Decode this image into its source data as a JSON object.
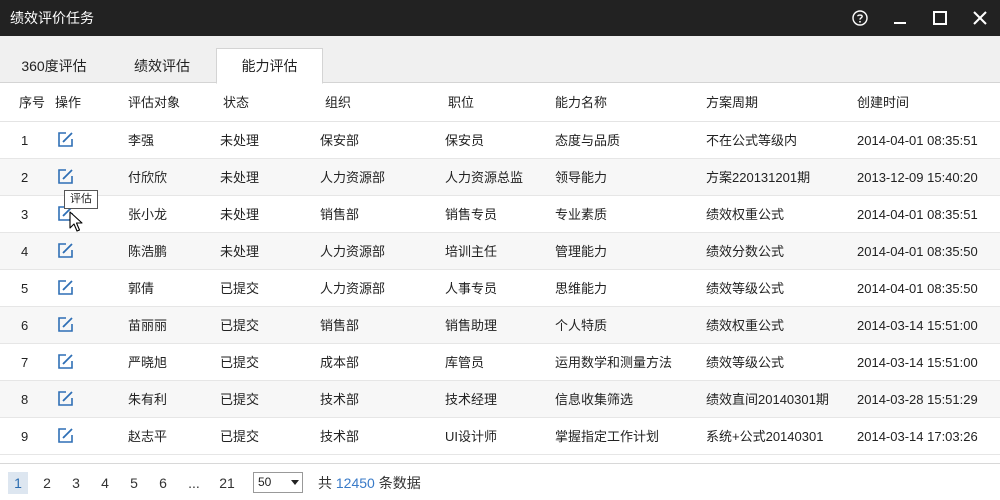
{
  "window": {
    "title": "绩效评价任务",
    "help_icon": "help-circle-icon",
    "minimize_icon": "minimize-icon",
    "maximize_icon": "maximize-icon",
    "close_icon": "close-icon"
  },
  "tabs": [
    {
      "label": "360度评估",
      "active": false
    },
    {
      "label": "绩效评估",
      "active": false
    },
    {
      "label": "能力评估",
      "active": true
    }
  ],
  "table": {
    "columns": [
      "序号",
      "操作",
      "评估对象",
      "状态",
      "组织",
      "职位",
      "能力名称",
      "方案周期",
      "创建时间"
    ],
    "rows": [
      {
        "no": "1",
        "name": "李强",
        "status": "未处理",
        "org": "保安部",
        "position": "保安员",
        "ability": "态度与品质",
        "cycle": "不在公式等级内",
        "created": "2014-04-01 08:35:51"
      },
      {
        "no": "2",
        "name": "付欣欣",
        "status": "未处理",
        "org": "人力资源部",
        "position": "人力资源总监",
        "ability": "领导能力",
        "cycle": "方案220131201期",
        "created": "2013-12-09 15:40:20"
      },
      {
        "no": "3",
        "name": "张小龙",
        "status": "未处理",
        "org": "销售部",
        "position": "销售专员",
        "ability": "专业素质",
        "cycle": "绩效权重公式",
        "created": "2014-04-01 08:35:51"
      },
      {
        "no": "4",
        "name": "陈浩鹏",
        "status": "未处理",
        "org": "人力资源部",
        "position": "培训主任",
        "ability": "管理能力",
        "cycle": "绩效分数公式",
        "created": "2014-04-01 08:35:50"
      },
      {
        "no": "5",
        "name": "郭倩",
        "status": "已提交",
        "org": "人力资源部",
        "position": "人事专员",
        "ability": "思维能力",
        "cycle": "绩效等级公式",
        "created": "2014-04-01 08:35:50"
      },
      {
        "no": "6",
        "name": "苗丽丽",
        "status": "已提交",
        "org": "销售部",
        "position": "销售助理",
        "ability": "个人特质",
        "cycle": "绩效权重公式",
        "created": "2014-03-14 15:51:00"
      },
      {
        "no": "7",
        "name": "严晓旭",
        "status": "已提交",
        "org": "成本部",
        "position": "库管员",
        "ability": "运用数学和测量方法",
        "cycle": "绩效等级公式",
        "created": "2014-03-14 15:51:00"
      },
      {
        "no": "8",
        "name": "朱有利",
        "status": "已提交",
        "org": "技术部",
        "position": "技术经理",
        "ability": "信息收集筛选",
        "cycle": "绩效直间20140301期",
        "created": "2014-03-28 15:51:29"
      },
      {
        "no": "9",
        "name": "赵志平",
        "status": "已提交",
        "org": "技术部",
        "position": "UI设计师",
        "ability": "掌握指定工作计划",
        "cycle": "系统+公式20140301",
        "created": "2014-03-14 17:03:26"
      }
    ],
    "action_icon": "edit-icon"
  },
  "tooltip": {
    "text": "评估"
  },
  "pagination": {
    "pages": [
      "1",
      "2",
      "3",
      "4",
      "5",
      "6",
      "...",
      "21"
    ],
    "current": "1",
    "page_size": "50",
    "total_prefix": "共",
    "total_count": "12450",
    "total_suffix": "条数据"
  },
  "colors": {
    "titlebar": "#222222",
    "accent": "#3a7bc8",
    "icon": "#2f6fb5"
  }
}
